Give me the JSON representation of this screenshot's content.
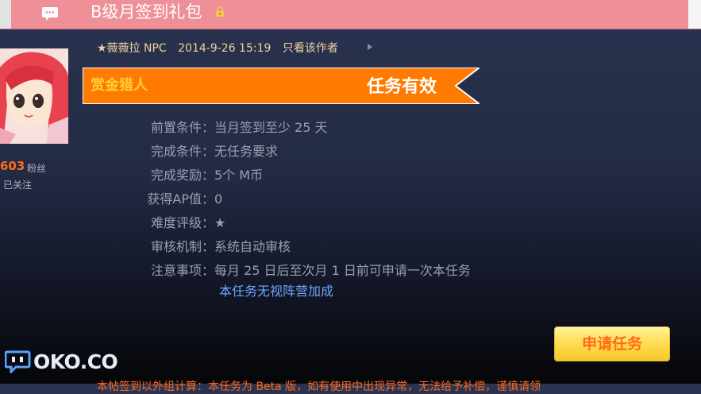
{
  "header": {
    "title": "B级月签到礼包",
    "chat_icon": "chat-bubble-icon",
    "lock_icon": "lock-icon"
  },
  "user": {
    "fans_count": "603",
    "fans_label": "粉丝",
    "follow_status": "已关注"
  },
  "post_meta": {
    "author": "★薇薇拉 NPC",
    "datetime": "2014-9-26 15:19",
    "only_author_link": "只看该作者"
  },
  "task": {
    "banner_left": "赏金猎人",
    "banner_right": "任务有效",
    "colors": {
      "banner": "#ff7a00",
      "banner_left_text": "#ffd033",
      "link_blue": "#6aa7ff",
      "button_text": "#ff6a1a"
    },
    "rows": [
      {
        "label": "前置条件：",
        "value": "当月签到至少 25 天"
      },
      {
        "label": "完成条件：",
        "value": "无任务要求"
      },
      {
        "label": "完成奖励：",
        "value": "5个 M币"
      },
      {
        "label": "获得AP值：",
        "value": "0"
      },
      {
        "label": "难度评级：",
        "value": "★"
      },
      {
        "label": "审核机制：",
        "value": "系统自动审核"
      },
      {
        "label": "注意事项：",
        "value": "每月 25 日后至次月 1 日前可申请一次本任务"
      }
    ],
    "note_highlight": "本任务无视阵营加成",
    "apply_button": "申请任务"
  },
  "watermark": {
    "text": "OKO.CO"
  },
  "bottom_text": "本帖签到以外组计算：本任务为 Beta 版，如有使用中出现异常，无法给予补偿，谨慎请领"
}
